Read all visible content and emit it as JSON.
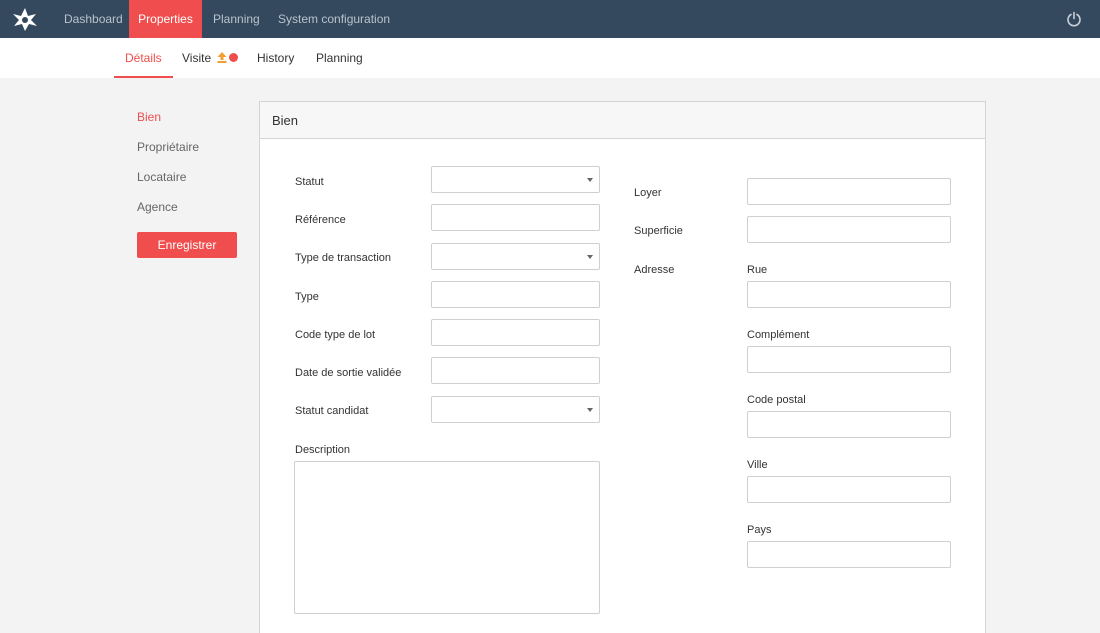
{
  "topnav": {
    "items": [
      "Dashboard",
      "Properties",
      "Planning",
      "System configuration"
    ],
    "active": "Properties"
  },
  "subnav": {
    "tabs": [
      "Détails",
      "Visite",
      "History",
      "Planning"
    ],
    "active": "Détails"
  },
  "sidemenu": {
    "items": [
      "Bien",
      "Propriétaire",
      "Locataire",
      "Agence"
    ],
    "active": "Bien",
    "save_label": "Enregistrer"
  },
  "panel": {
    "title": "Bien",
    "left_fields": {
      "statut": "Statut",
      "reference": "Référence",
      "type_transaction": "Type de transaction",
      "type": "Type",
      "code_type_lot": "Code type de lot",
      "date_sortie": "Date de sortie validée",
      "statut_candidat": "Statut candidat",
      "description": "Description"
    },
    "right_fields": {
      "loyer": "Loyer",
      "superficie": "Superficie",
      "adresse": "Adresse",
      "rue": "Rue",
      "complement": "Complément",
      "code_postal": "Code postal",
      "ville": "Ville",
      "pays": "Pays"
    }
  },
  "colors": {
    "accent": "#f04e4e",
    "nav_bg": "#34495e",
    "upload_badge": "#f0a030"
  },
  "icons": {
    "logo": "star-logo-icon",
    "power": "power-icon",
    "upload": "upload-icon",
    "dropdown": "caret-down-icon"
  }
}
